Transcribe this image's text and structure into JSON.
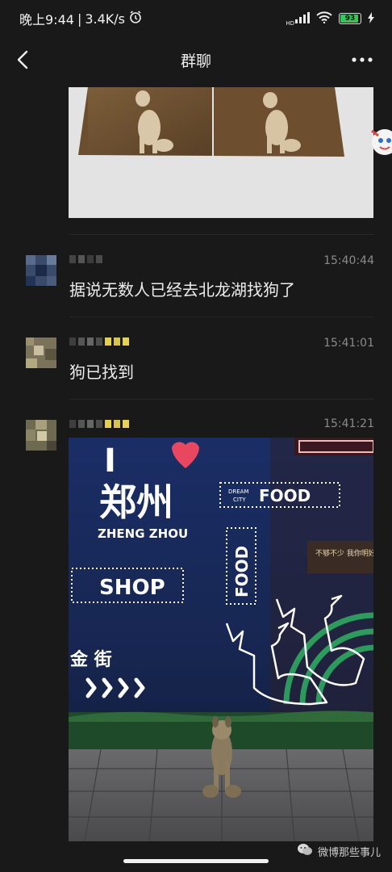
{
  "status_bar": {
    "time": "晚上9:44",
    "speed": "3.4K/s",
    "hd_label": "HD",
    "battery": "93",
    "icons": [
      "alarm-icon",
      "signal-icon",
      "wifi-icon",
      "battery-icon",
      "charging-icon"
    ]
  },
  "header": {
    "title": "群聊",
    "back_icon": "chevron-left-icon",
    "more_icon": "more-dots-icon"
  },
  "messages": [
    {
      "time": "15:40:44",
      "text": "据说无数人已经去北龙湖找狗了"
    },
    {
      "time": "15:41:01",
      "text": "狗已找到"
    },
    {
      "time": "15:41:21",
      "image": "dog-photo"
    }
  ],
  "photo_sign": {
    "i": "I",
    "city_cn": "郑州",
    "city_en": "ZHENG ZHOU",
    "dream": "DREAM",
    "city": "CITY",
    "food": "FOOD",
    "food_vertical": "FOOD",
    "shop": "SHOP",
    "side_sign": "不够不少 我你明好",
    "street_chars": "金 街"
  },
  "watermark": {
    "text": "微博那些事儿"
  },
  "colors": {
    "background": "#191919",
    "text": "#ececec",
    "time": "#8a8a8a",
    "battery_green": "#34c759",
    "heart": "#e8475f"
  }
}
